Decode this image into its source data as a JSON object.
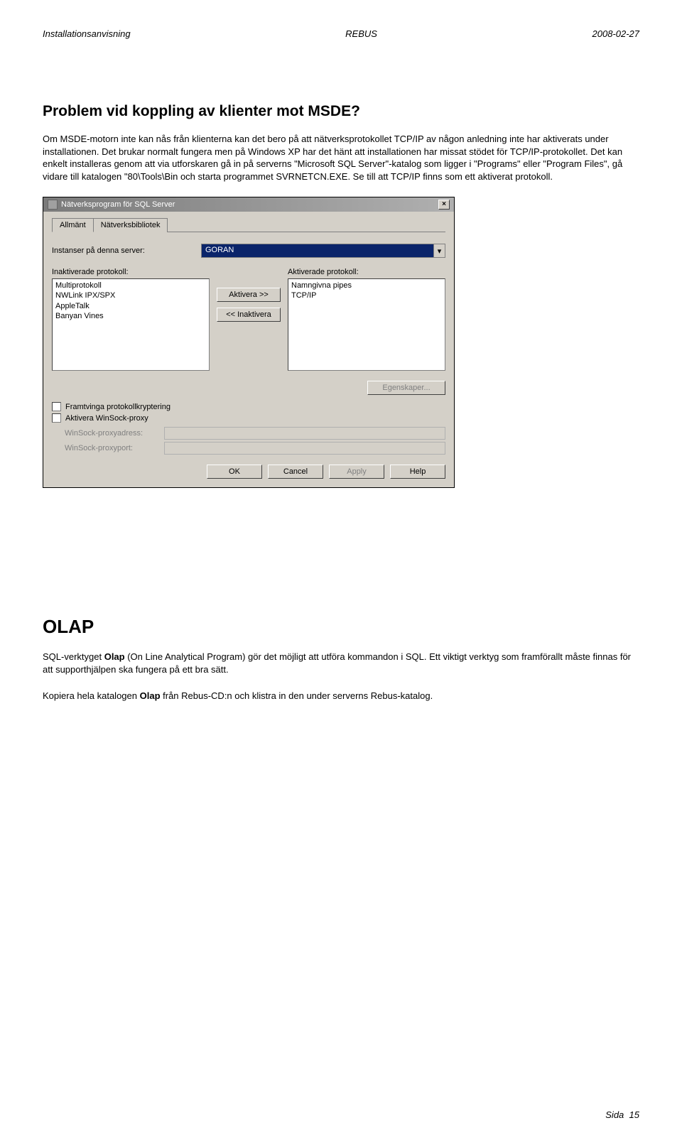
{
  "header": {
    "left": "Installationsanvisning",
    "center": "REBUS",
    "right": "2008-02-27"
  },
  "section1": {
    "title": "Problem vid koppling av klienter mot MSDE?",
    "body": "Om MSDE-motorn inte kan nås från klienterna kan det bero på att nätverksprotokollet TCP/IP av någon anledning inte har aktiverats under installationen. Det brukar normalt fungera men på Windows XP har det hänt att installationen har missat stödet för TCP/IP-protokollet. Det kan enkelt installeras genom att via utforskaren gå in på serverns \"Microsoft SQL Server\"-katalog som ligger i \"Programs\" eller \"Program Files\", gå vidare till katalogen \"80\\Tools\\Bin och starta programmet SVRNETCN.EXE. Se till att TCP/IP finns som ett aktiverat protokoll."
  },
  "dialog": {
    "title": "Nätverksprogram för SQL Server",
    "tabs": {
      "general": "Allmänt",
      "library": "Nätverksbibliotek"
    },
    "instance_label": "Instanser på denna server:",
    "instance_value": "GORAN",
    "disabled_label": "Inaktiverade protokoll:",
    "enabled_label": "Aktiverade protokoll:",
    "disabled_list": [
      "Multiprotokoll",
      "NWLink IPX/SPX",
      "AppleTalk",
      "Banyan Vines"
    ],
    "enabled_list": [
      "Namngivna pipes",
      "TCP/IP"
    ],
    "btn_activate": "Aktivera >>",
    "btn_deactivate": "<< Inaktivera",
    "btn_properties": "Egenskaper...",
    "cb_force": "Framtvinga protokollkryptering",
    "cb_winsock": "Aktivera WinSock-proxy",
    "proxy_addr": "WinSock-proxyadress:",
    "proxy_port": "WinSock-proxyport:",
    "btn_ok": "OK",
    "btn_cancel": "Cancel",
    "btn_apply": "Apply",
    "btn_help": "Help"
  },
  "section2": {
    "title": "OLAP",
    "body1_a": "SQL-verktyget ",
    "body1_b": "Olap",
    "body1_c": " (On Line Analytical Program) gör det möjligt att utföra kommandon i SQL. Ett viktigt verktyg som framförallt måste finnas för att supporthjälpen ska fungera på ett bra sätt.",
    "body2_a": "Kopiera hela katalogen ",
    "body2_b": "Olap",
    "body2_c": " från Rebus-CD:n och klistra in den under serverns Rebus-katalog."
  },
  "footer": {
    "label": "Sida",
    "page": "15"
  }
}
